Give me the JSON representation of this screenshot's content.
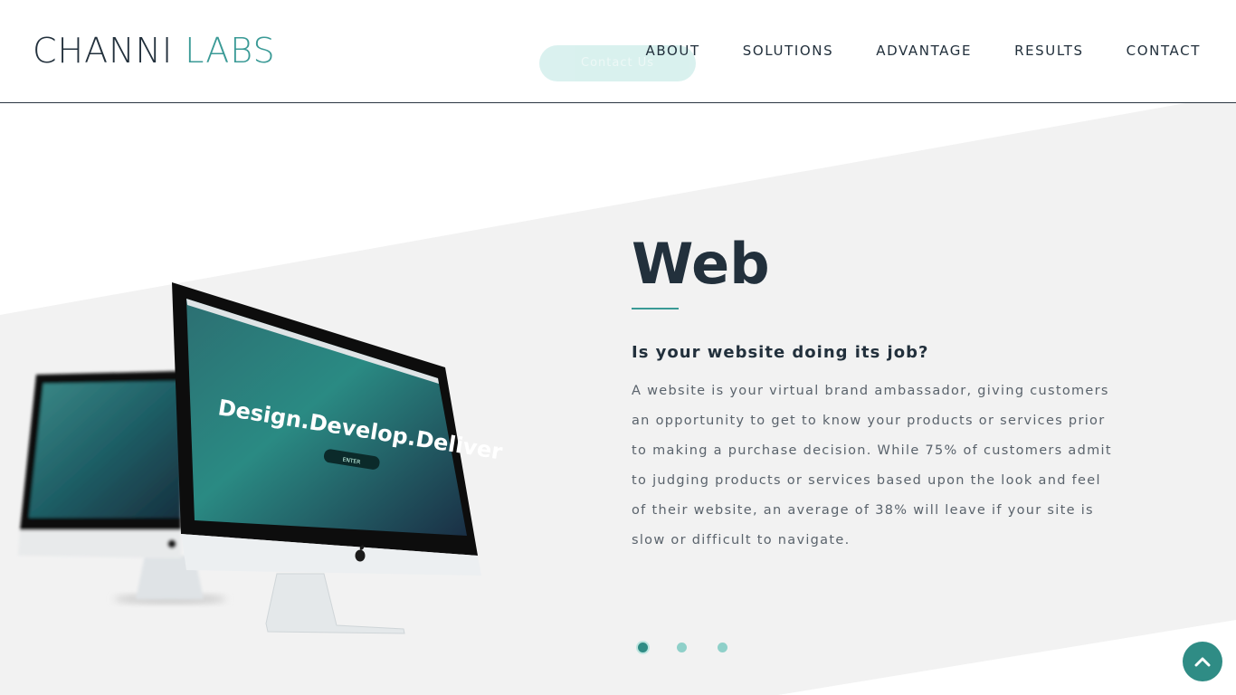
{
  "header": {
    "logo_part1": "CHANNI",
    "logo_part2": "LABS",
    "ghost_button_label": "Contact Us",
    "nav": [
      {
        "label": "ABOUT"
      },
      {
        "label": "SOLUTIONS"
      },
      {
        "label": "ADVANTAGE"
      },
      {
        "label": "RESULTS"
      },
      {
        "label": "CONTACT"
      }
    ]
  },
  "hero": {
    "title": "Web",
    "subtitle": "Is your website doing its job?",
    "body": "A website is your virtual brand ambassador, giving customers an opportunity to get to know your products or services prior to making a purchase decision. While 75% of customers admit to judging products or services based upon the look and feel of their website, an average of 38% will leave if your site is slow or difficult to navigate.",
    "screen_headline": "Design.Develop.Deliver",
    "screen_button": "ENTER",
    "slides": [
      {
        "active": true
      },
      {
        "active": false
      },
      {
        "active": false
      }
    ]
  },
  "colors": {
    "brand_dark": "#22303c",
    "brand_teal": "#3a9a96",
    "hero_bg": "#f2f2f2",
    "accent_button": "#2f8c85"
  },
  "icons": {
    "back_to_top": "chevron-up-icon",
    "monitor_logo": "apple-logo-icon"
  }
}
